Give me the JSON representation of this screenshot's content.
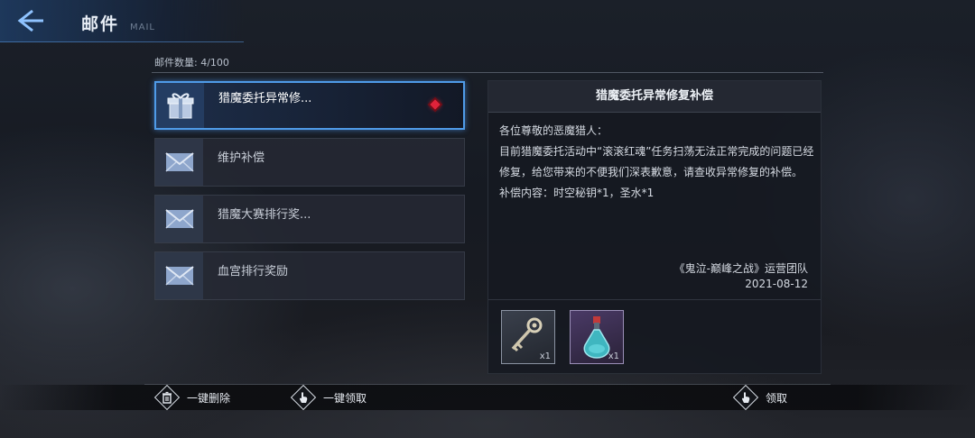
{
  "header": {
    "title": "邮件",
    "subtitle": "MAIL"
  },
  "mail_count": "邮件数量: 4/100",
  "mails": [
    {
      "label": "猎魔委托异常修...",
      "icon": "gift-icon",
      "selected": true,
      "unread": true
    },
    {
      "label": "维护补偿",
      "icon": "envelope-icon",
      "selected": false,
      "unread": false
    },
    {
      "label": "猎魔大赛排行奖...",
      "icon": "envelope-icon",
      "selected": false,
      "unread": false
    },
    {
      "label": "血宫排行奖励",
      "icon": "envelope-icon",
      "selected": false,
      "unread": false
    }
  ],
  "detail": {
    "title": "猎魔委托异常修复补偿",
    "body": [
      "各位尊敬的恶魔猎人：",
      "目前猎魔委托活动中“滚滚红魂”任务扫荡无法正常完成的问题已经修复，给您带来的不便我们深表歉意，请查收异常修复的补偿。",
      "补偿内容：时空秘钥*1，圣水*1"
    ],
    "signature": "《鬼泣-巅峰之战》运营团队",
    "date": "2021-08-12",
    "attachments": [
      {
        "name": "key-item",
        "qty": "x1"
      },
      {
        "name": "potion-item",
        "qty": "x1"
      }
    ]
  },
  "actions": {
    "delete_all": "一键删除",
    "claim_all": "一键领取",
    "claim": "领取"
  },
  "colors": {
    "accent": "#4f9be8",
    "unread_dot": "#e0233a"
  }
}
